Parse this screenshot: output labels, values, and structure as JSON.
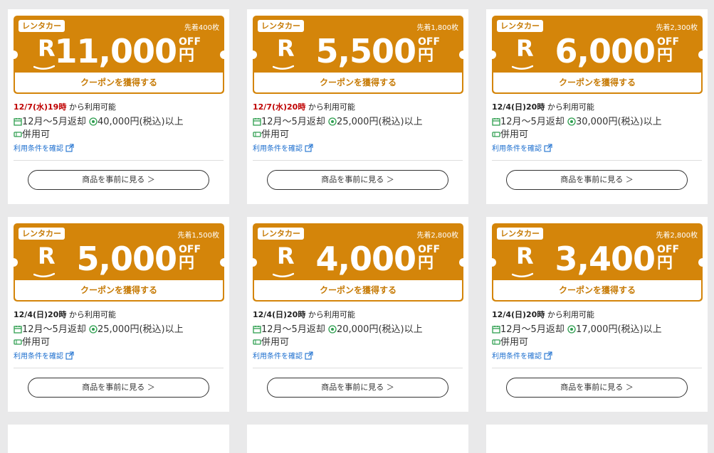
{
  "colors": {
    "accent": "#d4850a",
    "deadline_red": "#bf0000",
    "link": "#1d6fcf"
  },
  "common": {
    "category": "レンタカー",
    "off": "OFF",
    "yen": "円",
    "get_label": "クーポンを獲得する",
    "from_label": "から利用可能",
    "return_period": "12月～5月返却",
    "combinable": "併用可",
    "terms_label": "利用条件を確認",
    "see_items_label": "商品を事前に見る ＞",
    "r_logo": "R"
  },
  "coupons": [
    {
      "limit": "先着400枚",
      "amount": "11,000",
      "start": "12/7(水)19時",
      "start_red": true,
      "min_purchase": "40,000円(税込)以上"
    },
    {
      "limit": "先着1,800枚",
      "amount": "5,500",
      "start": "12/7(水)20時",
      "start_red": true,
      "min_purchase": "25,000円(税込)以上"
    },
    {
      "limit": "先着2,300枚",
      "amount": "6,000",
      "start": "12/4(日)20時",
      "start_red": false,
      "min_purchase": "30,000円(税込)以上"
    },
    {
      "limit": "先着1,500枚",
      "amount": "5,000",
      "start": "12/4(日)20時",
      "start_red": false,
      "min_purchase": "25,000円(税込)以上"
    },
    {
      "limit": "先着2,800枚",
      "amount": "4,000",
      "start": "12/4(日)20時",
      "start_red": false,
      "min_purchase": "20,000円(税込)以上"
    },
    {
      "limit": "先着2,800枚",
      "amount": "3,400",
      "start": "12/4(日)20時",
      "start_red": false,
      "min_purchase": "17,000円(税込)以上"
    }
  ]
}
